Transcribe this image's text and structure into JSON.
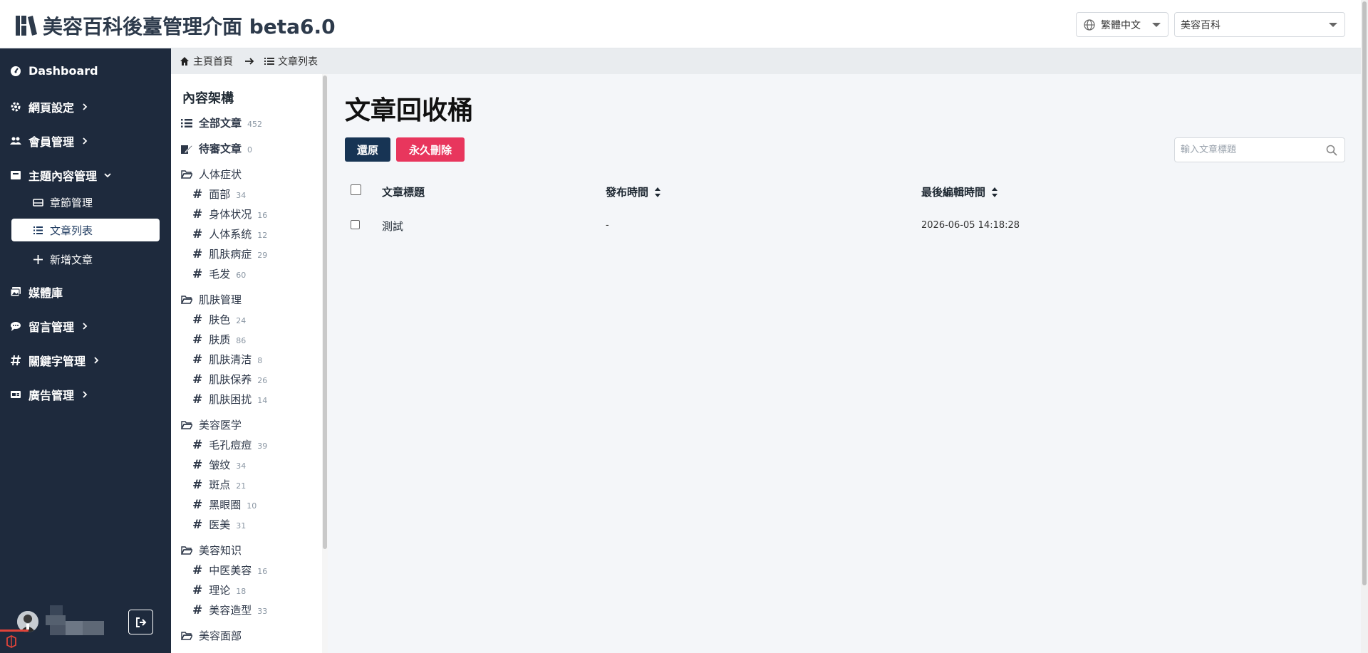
{
  "header": {
    "title": "美容百科後臺管理介面 beta6.0",
    "language": "繁體中文",
    "site": "美容百科"
  },
  "sidebar": {
    "items": [
      {
        "label": "Dashboard",
        "icon": "dashboard-icon"
      },
      {
        "label": "網頁設定",
        "icon": "gear-icon"
      },
      {
        "label": "會員管理",
        "icon": "users-icon"
      },
      {
        "label": "主題內容管理",
        "icon": "book-icon"
      },
      {
        "label": "媒體庫",
        "icon": "images-icon"
      },
      {
        "label": "留言管理",
        "icon": "comment-icon"
      },
      {
        "label": "關鍵字管理",
        "icon": "hashtag-icon"
      },
      {
        "label": "廣告管理",
        "icon": "ad-icon"
      }
    ],
    "subitems": [
      {
        "label": "章節管理"
      },
      {
        "label": "文章列表"
      },
      {
        "label": "新增文章"
      }
    ]
  },
  "breadcrumb": {
    "home": "主頁首頁",
    "current": "文章列表"
  },
  "categories": {
    "title": "內容架構",
    "all": {
      "label": "全部文章",
      "count": "452"
    },
    "pending": {
      "label": "待審文章",
      "count": "0"
    },
    "groups": [
      {
        "name": "人体症状",
        "tags": [
          {
            "label": "面部",
            "count": "34"
          },
          {
            "label": "身体状况",
            "count": "16"
          },
          {
            "label": "人体系统",
            "count": "12"
          },
          {
            "label": "肌肤病症",
            "count": "29"
          },
          {
            "label": "毛发",
            "count": "60"
          }
        ]
      },
      {
        "name": "肌肤管理",
        "tags": [
          {
            "label": "肤色",
            "count": "24"
          },
          {
            "label": "肤质",
            "count": "86"
          },
          {
            "label": "肌肤清洁",
            "count": "8"
          },
          {
            "label": "肌肤保养",
            "count": "26"
          },
          {
            "label": "肌肤困扰",
            "count": "14"
          }
        ]
      },
      {
        "name": "美容医学",
        "tags": [
          {
            "label": "毛孔痘痘",
            "count": "39"
          },
          {
            "label": "皱纹",
            "count": "34"
          },
          {
            "label": "斑点",
            "count": "21"
          },
          {
            "label": "黑眼圈",
            "count": "10"
          },
          {
            "label": "医美",
            "count": "31"
          }
        ]
      },
      {
        "name": "美容知识",
        "tags": [
          {
            "label": "中医美容",
            "count": "16"
          },
          {
            "label": "理论",
            "count": "18"
          },
          {
            "label": "美容造型",
            "count": "33"
          }
        ]
      },
      {
        "name": "美容面部",
        "tags": []
      }
    ]
  },
  "main": {
    "title": "文章回收桶",
    "restore_label": "還原",
    "delete_label": "永久刪除",
    "search_placeholder": "輸入文章標題",
    "columns": [
      "文章標題",
      "發布時間",
      "最後編輯時間"
    ],
    "rows": [
      {
        "title": "測試",
        "published": "-",
        "edited": "2026-06-05 14:18:28"
      }
    ]
  },
  "colors": {
    "sidebar_bg": "#1e2a3d",
    "restore_btn": "#173454",
    "delete_btn": "#e8365d"
  }
}
